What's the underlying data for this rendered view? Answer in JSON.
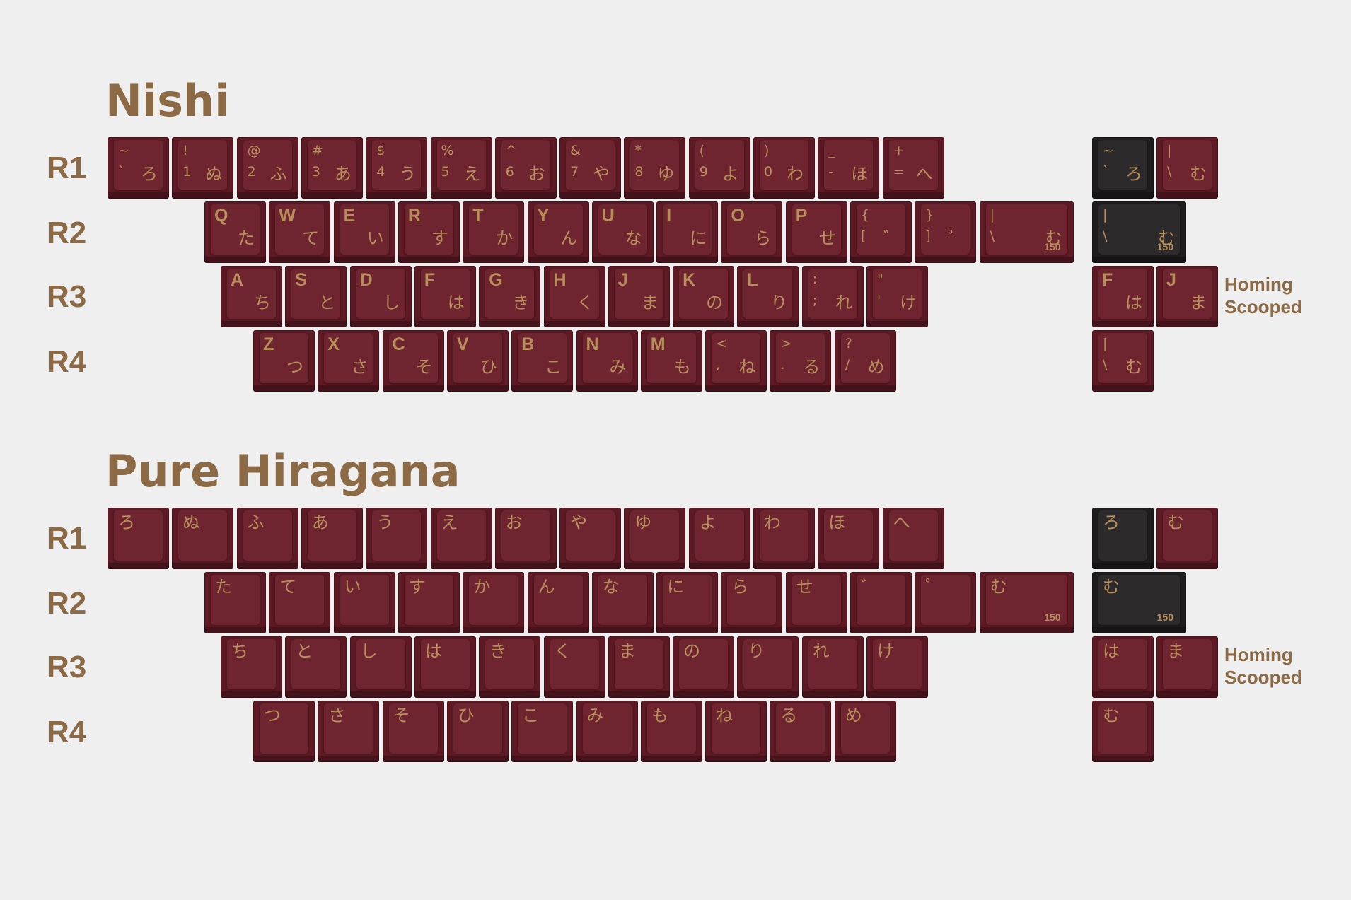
{
  "nishi": {
    "title": "Nishi",
    "rows": {
      "r1": "R1",
      "r2": "R2",
      "r3": "R3",
      "r4": "R4"
    },
    "r1": [
      {
        "shift": "~",
        "base": "`",
        "kana": "ろ"
      },
      {
        "shift": "!",
        "base": "1",
        "kana": "ぬ"
      },
      {
        "shift": "@",
        "base": "2",
        "kana": "ふ"
      },
      {
        "shift": "#",
        "base": "3",
        "kana": "あ"
      },
      {
        "shift": "$",
        "base": "4",
        "kana": "う"
      },
      {
        "shift": "%",
        "base": "5",
        "kana": "え"
      },
      {
        "shift": "^",
        "base": "6",
        "kana": "お"
      },
      {
        "shift": "&",
        "base": "7",
        "kana": "や"
      },
      {
        "shift": "*",
        "base": "8",
        "kana": "ゆ"
      },
      {
        "shift": "(",
        "base": "9",
        "kana": "よ"
      },
      {
        "shift": ")",
        "base": "0",
        "kana": "わ"
      },
      {
        "shift": "_",
        "base": "-",
        "kana": "ほ"
      },
      {
        "shift": "+",
        "base": "=",
        "kana": "へ"
      }
    ],
    "r2": [
      {
        "legend": "Q",
        "kana": "た"
      },
      {
        "legend": "W",
        "kana": "て"
      },
      {
        "legend": "E",
        "kana": "い"
      },
      {
        "legend": "R",
        "kana": "す"
      },
      {
        "legend": "T",
        "kana": "か"
      },
      {
        "legend": "Y",
        "kana": "ん"
      },
      {
        "legend": "U",
        "kana": "な"
      },
      {
        "legend": "I",
        "kana": "に"
      },
      {
        "legend": "O",
        "kana": "ら"
      },
      {
        "legend": "P",
        "kana": "せ"
      },
      {
        "shift": "{",
        "base": "[",
        "kana": "゛"
      },
      {
        "shift": "}",
        "base": "]",
        "kana": "゜"
      },
      {
        "shift": "|",
        "base": "\\",
        "kana": "む",
        "size": "150"
      }
    ],
    "r3": [
      {
        "legend": "A",
        "kana": "ち"
      },
      {
        "legend": "S",
        "kana": "と"
      },
      {
        "legend": "D",
        "kana": "し"
      },
      {
        "legend": "F",
        "kana": "は"
      },
      {
        "legend": "G",
        "kana": "き"
      },
      {
        "legend": "H",
        "kana": "く"
      },
      {
        "legend": "J",
        "kana": "ま"
      },
      {
        "legend": "K",
        "kana": "の"
      },
      {
        "legend": "L",
        "kana": "り"
      },
      {
        "shift": ":",
        "base": ";",
        "kana": "れ"
      },
      {
        "shift": "\"",
        "base": "'",
        "kana": "け"
      }
    ],
    "r4": [
      {
        "legend": "Z",
        "kana": "つ"
      },
      {
        "legend": "X",
        "kana": "さ"
      },
      {
        "legend": "C",
        "kana": "そ"
      },
      {
        "legend": "V",
        "kana": "ひ"
      },
      {
        "legend": "B",
        "kana": "こ"
      },
      {
        "legend": "N",
        "kana": "み"
      },
      {
        "legend": "M",
        "kana": "も"
      },
      {
        "shift": "<",
        "base": ",",
        "kana": "ね"
      },
      {
        "shift": ">",
        "base": ".",
        "kana": "る"
      },
      {
        "shift": "?",
        "base": "/",
        "kana": "め"
      }
    ],
    "extras": {
      "r1": [
        {
          "shift": "~",
          "base": "`",
          "kana": "ろ",
          "color": "#1f1d1e"
        },
        {
          "shift": "|",
          "base": "\\",
          "kana": "む",
          "color": "#5e1a24"
        }
      ],
      "r2": [
        {
          "shift": "|",
          "base": "\\",
          "kana": "む",
          "size": "150",
          "color": "#1f1d1e"
        }
      ],
      "r3": [
        {
          "legend": "F",
          "kana": "は"
        },
        {
          "legend": "J",
          "kana": "ま"
        }
      ],
      "r4": [
        {
          "shift": "|",
          "base": "\\",
          "kana": "む"
        }
      ]
    },
    "note": [
      "Homing",
      "Scooped"
    ]
  },
  "hiragana": {
    "title": "Pure Hiragana",
    "rows": {
      "r1": "R1",
      "r2": "R2",
      "r3": "R3",
      "r4": "R4"
    },
    "r1": [
      "ろ",
      "ぬ",
      "ふ",
      "あ",
      "う",
      "え",
      "お",
      "や",
      "ゆ",
      "よ",
      "わ",
      "ほ",
      "へ"
    ],
    "r2": [
      "た",
      "て",
      "い",
      "す",
      "か",
      "ん",
      "な",
      "に",
      "ら",
      "せ",
      "゛",
      "゜",
      "む"
    ],
    "r2_last_size": "150",
    "r3": [
      "ち",
      "と",
      "し",
      "は",
      "き",
      "く",
      "ま",
      "の",
      "り",
      "れ",
      "け"
    ],
    "r4": [
      "つ",
      "さ",
      "そ",
      "ひ",
      "こ",
      "み",
      "も",
      "ね",
      "る",
      "め"
    ],
    "extras": {
      "r1": [
        "ろ",
        "む"
      ],
      "r2": [
        "む"
      ],
      "r2_size": "150",
      "r3": [
        "は",
        "ま"
      ],
      "r4": [
        "む"
      ]
    },
    "note": [
      "Homing",
      "Scooped"
    ]
  }
}
